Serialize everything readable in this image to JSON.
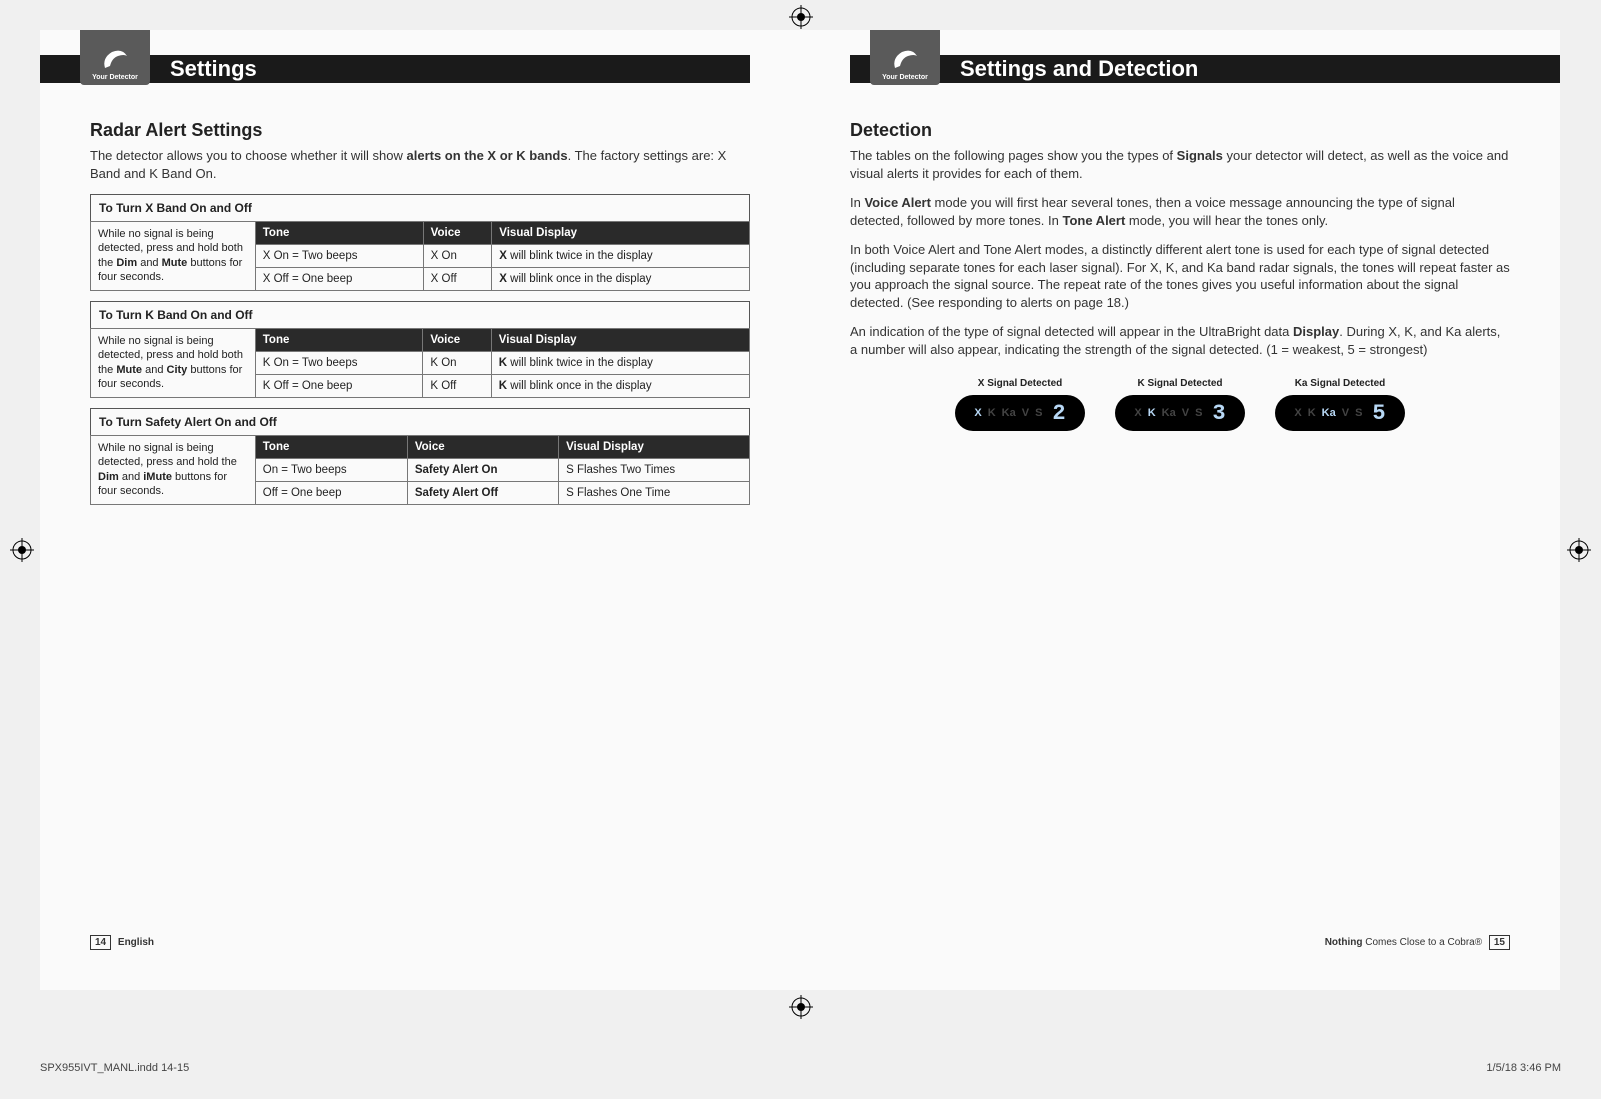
{
  "left": {
    "badge_label": "Your Detector",
    "header_title": "Settings",
    "section_title": "Radar Alert Settings",
    "intro_html": "The detector allows you to choose whether it will show <b>alerts on the X or K bands</b>. The factory settings are: X Band and K Band On.",
    "table_x": {
      "caption": "To Turn X Band On and Off",
      "instr_html": "While no signal is being detected, press and hold both the <b>Dim</b> and <b>Mute</b> buttons for four seconds.",
      "h_tone": "Tone",
      "h_voice": "Voice",
      "h_disp": "Visual Display",
      "r1_tone": "X On = Two beeps",
      "r1_voice": "X On",
      "r1_disp_html": "<b>X</b> will blink twice in the display",
      "r2_tone": "X Off = One beep",
      "r2_voice": "X Off",
      "r2_disp_html": "<b>X</b> will blink once in the display"
    },
    "table_k": {
      "caption": "To Turn K Band On and Off",
      "instr_html": "While no signal is being detected, press and hold both the <b>Mute</b> and <b>City</b> buttons for four seconds.",
      "h_tone": "Tone",
      "h_voice": "Voice",
      "h_disp": "Visual Display",
      "r1_tone": "K On = Two beeps",
      "r1_voice": "K On",
      "r1_disp_html": "<b>K</b> will blink twice in the display",
      "r2_tone": "K Off = One beep",
      "r2_voice": "K Off",
      "r2_disp_html": "<b>K</b> will blink once in the display"
    },
    "table_s": {
      "caption": "To Turn Safety Alert On and Off",
      "instr_html": "While no signal is being detected, press and hold the <b>Dim</b> and <b>iMute</b> buttons for four seconds.",
      "h_tone": "Tone",
      "h_voice": "Voice",
      "h_disp": "Visual Display",
      "r1_tone": "On = Two beeps",
      "r1_voice": "Safety Alert On",
      "r1_disp": "S Flashes Two Times",
      "r2_tone": "Off = One beep",
      "r2_voice": "Safety Alert Off",
      "r2_disp": "S Flashes One Time"
    },
    "footer_page": "14",
    "footer_lang": "English"
  },
  "right": {
    "badge_label": "Your Detector",
    "header_title": "Settings and Detection",
    "section_title": "Detection",
    "p1_html": "The tables on the following pages show you the types of <b>Signals</b> your detector will detect, as well as the voice and visual alerts it provides for each of them.",
    "p2_html": "In <b>Voice Alert</b> mode you will first hear several tones, then a voice message announcing the type of signal detected, followed by more tones. In <b>Tone Alert</b> mode, you will hear the tones only.",
    "p3": "In both Voice Alert and Tone Alert modes, a distinctly different alert tone is used for each type of signal detected (including separate tones for each laser signal). For X, K, and Ka band radar signals, the tones will repeat faster as you approach the signal source. The repeat rate of the tones gives you useful information about the signal detected. (See responding to alerts on page 18.)",
    "p4_html": "An indication of the type of signal detected will appear in the UltraBright data <b>Display</b>. During X, K, and Ka alerts, a number will also appear, indicating the strength of the signal detected. (1 = weakest, 5 = strongest)",
    "displays": [
      {
        "label": "X Signal Detected",
        "on": "X",
        "digit": "2"
      },
      {
        "label": "K Signal Detected",
        "on": "K",
        "digit": "3"
      },
      {
        "label": "Ka Signal Detected",
        "on": "Ka",
        "digit": "5"
      }
    ],
    "lcd_bands": [
      "X",
      "K",
      "Ka",
      "V",
      "S"
    ],
    "footer_text_html": "<b>Nothing</b> Comes Close to a Cobra®",
    "footer_page": "15"
  },
  "indd": {
    "file": "SPX955IVT_MANL.indd   14-15",
    "date": "1/5/18   3:46 PM"
  }
}
